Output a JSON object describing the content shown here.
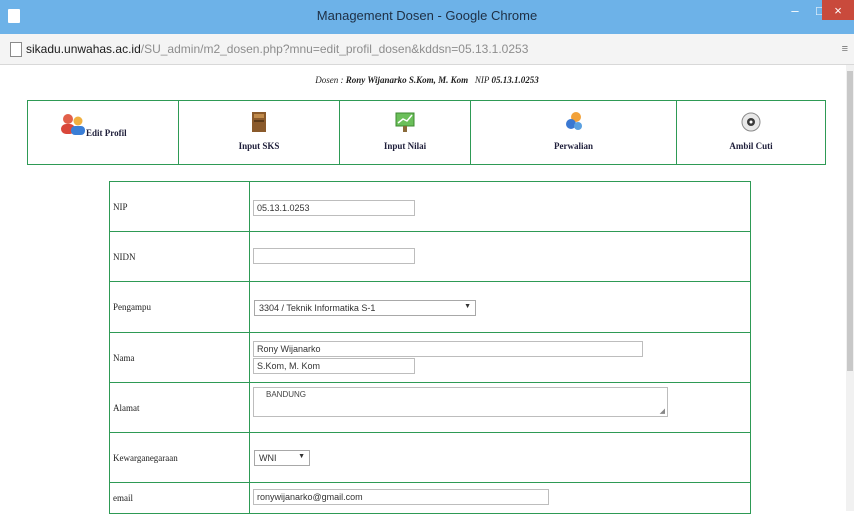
{
  "window": {
    "title": "Management Dosen - Google Chrome",
    "minimize": "–",
    "maximize": "□",
    "close": "×"
  },
  "browser": {
    "url_host": "sikadu.unwahas.ac.id",
    "url_path": "/SU_admin/m2_dosen.php?mnu=edit_profil_dosen&kddsn=05.13.1.0253",
    "menu_glyph": "≡"
  },
  "header": {
    "dosen_label": "Dosen :",
    "dosen_name": "Rony Wijanarko S.Kom, M. Kom",
    "nip_label": "NIP",
    "nip_value": "05.13.1.0253"
  },
  "nav": {
    "items": [
      {
        "label": "Edit Profil",
        "icon": "users-icon"
      },
      {
        "label": "Input SKS",
        "icon": "book-icon"
      },
      {
        "label": "Input Nilai",
        "icon": "chart-board-icon"
      },
      {
        "label": "Perwalian",
        "icon": "people-icon"
      },
      {
        "label": "Ambil Cuti",
        "icon": "disc-icon"
      }
    ]
  },
  "form": {
    "nip": {
      "label": "NIP",
      "value": "05.13.1.0253"
    },
    "nidn": {
      "label": "NIDN",
      "value": ""
    },
    "pengampu": {
      "label": "Pengampu",
      "value": "3304  /  Teknik Informatika S-1"
    },
    "nama": {
      "label": "Nama",
      "first": "Rony Wijanarko",
      "title": "S.Kom, M. Kom"
    },
    "alamat": {
      "label": "Alamat",
      "value": "BANDUNG"
    },
    "kewarganegaraan": {
      "label": "Kewarganegaraan",
      "value": "WNI"
    },
    "email": {
      "label": "email",
      "value": "ronywijanarko@gmail.com"
    }
  },
  "colors": {
    "titlebar": "#6db2e8",
    "close_button": "#c94a3c",
    "table_border": "#2e9a55"
  }
}
